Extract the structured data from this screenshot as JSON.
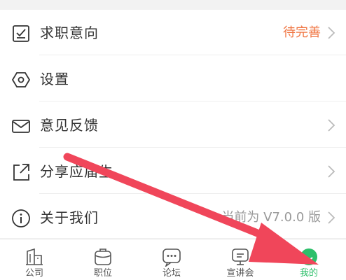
{
  "menu": {
    "items": [
      {
        "label": "求职意向",
        "value": "待完善",
        "icon": "checklist-icon"
      },
      {
        "label": "设置",
        "value": "",
        "icon": "settings-hexagon-icon"
      },
      {
        "label": "意见反馈",
        "value": "",
        "icon": "mail-icon"
      },
      {
        "label": "分享应届生",
        "value": "",
        "icon": "share-icon"
      },
      {
        "label": "关于我们",
        "value": "当前为 V7.0.0 版",
        "icon": "info-icon"
      }
    ]
  },
  "tabbar": {
    "tabs": [
      {
        "label": "公司",
        "icon": "company-building-icon"
      },
      {
        "label": "职位",
        "icon": "briefcase-icon"
      },
      {
        "label": "论坛",
        "icon": "chat-bubble-icon"
      },
      {
        "label": "宣讲会",
        "icon": "presentation-icon"
      },
      {
        "label": "我的",
        "icon": "profile-smile-icon",
        "active": true
      }
    ]
  },
  "colors": {
    "accent_green": "#2dbf6a",
    "warning_orange": "#f07846",
    "annotation_arrow": "#f0465a"
  }
}
